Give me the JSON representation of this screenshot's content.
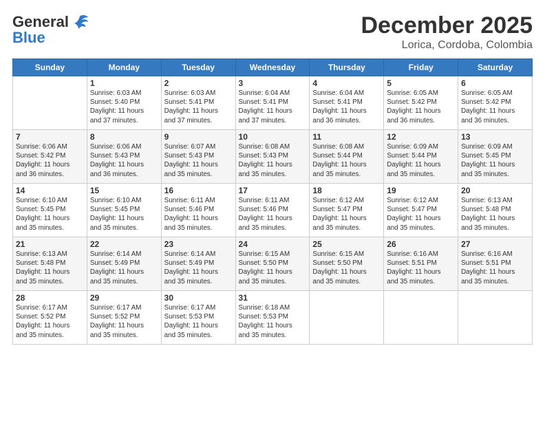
{
  "header": {
    "logo_line1": "General",
    "logo_line2": "Blue",
    "month": "December 2025",
    "location": "Lorica, Cordoba, Colombia"
  },
  "days_of_week": [
    "Sunday",
    "Monday",
    "Tuesday",
    "Wednesday",
    "Thursday",
    "Friday",
    "Saturday"
  ],
  "weeks": [
    [
      {
        "num": "",
        "info": ""
      },
      {
        "num": "1",
        "info": "Sunrise: 6:03 AM\nSunset: 5:40 PM\nDaylight: 11 hours\nand 37 minutes."
      },
      {
        "num": "2",
        "info": "Sunrise: 6:03 AM\nSunset: 5:41 PM\nDaylight: 11 hours\nand 37 minutes."
      },
      {
        "num": "3",
        "info": "Sunrise: 6:04 AM\nSunset: 5:41 PM\nDaylight: 11 hours\nand 37 minutes."
      },
      {
        "num": "4",
        "info": "Sunrise: 6:04 AM\nSunset: 5:41 PM\nDaylight: 11 hours\nand 36 minutes."
      },
      {
        "num": "5",
        "info": "Sunrise: 6:05 AM\nSunset: 5:42 PM\nDaylight: 11 hours\nand 36 minutes."
      },
      {
        "num": "6",
        "info": "Sunrise: 6:05 AM\nSunset: 5:42 PM\nDaylight: 11 hours\nand 36 minutes."
      }
    ],
    [
      {
        "num": "7",
        "info": "Sunrise: 6:06 AM\nSunset: 5:42 PM\nDaylight: 11 hours\nand 36 minutes."
      },
      {
        "num": "8",
        "info": "Sunrise: 6:06 AM\nSunset: 5:43 PM\nDaylight: 11 hours\nand 36 minutes."
      },
      {
        "num": "9",
        "info": "Sunrise: 6:07 AM\nSunset: 5:43 PM\nDaylight: 11 hours\nand 35 minutes."
      },
      {
        "num": "10",
        "info": "Sunrise: 6:08 AM\nSunset: 5:43 PM\nDaylight: 11 hours\nand 35 minutes."
      },
      {
        "num": "11",
        "info": "Sunrise: 6:08 AM\nSunset: 5:44 PM\nDaylight: 11 hours\nand 35 minutes."
      },
      {
        "num": "12",
        "info": "Sunrise: 6:09 AM\nSunset: 5:44 PM\nDaylight: 11 hours\nand 35 minutes."
      },
      {
        "num": "13",
        "info": "Sunrise: 6:09 AM\nSunset: 5:45 PM\nDaylight: 11 hours\nand 35 minutes."
      }
    ],
    [
      {
        "num": "14",
        "info": "Sunrise: 6:10 AM\nSunset: 5:45 PM\nDaylight: 11 hours\nand 35 minutes."
      },
      {
        "num": "15",
        "info": "Sunrise: 6:10 AM\nSunset: 5:45 PM\nDaylight: 11 hours\nand 35 minutes."
      },
      {
        "num": "16",
        "info": "Sunrise: 6:11 AM\nSunset: 5:46 PM\nDaylight: 11 hours\nand 35 minutes."
      },
      {
        "num": "17",
        "info": "Sunrise: 6:11 AM\nSunset: 5:46 PM\nDaylight: 11 hours\nand 35 minutes."
      },
      {
        "num": "18",
        "info": "Sunrise: 6:12 AM\nSunset: 5:47 PM\nDaylight: 11 hours\nand 35 minutes."
      },
      {
        "num": "19",
        "info": "Sunrise: 6:12 AM\nSunset: 5:47 PM\nDaylight: 11 hours\nand 35 minutes."
      },
      {
        "num": "20",
        "info": "Sunrise: 6:13 AM\nSunset: 5:48 PM\nDaylight: 11 hours\nand 35 minutes."
      }
    ],
    [
      {
        "num": "21",
        "info": "Sunrise: 6:13 AM\nSunset: 5:48 PM\nDaylight: 11 hours\nand 35 minutes."
      },
      {
        "num": "22",
        "info": "Sunrise: 6:14 AM\nSunset: 5:49 PM\nDaylight: 11 hours\nand 35 minutes."
      },
      {
        "num": "23",
        "info": "Sunrise: 6:14 AM\nSunset: 5:49 PM\nDaylight: 11 hours\nand 35 minutes."
      },
      {
        "num": "24",
        "info": "Sunrise: 6:15 AM\nSunset: 5:50 PM\nDaylight: 11 hours\nand 35 minutes."
      },
      {
        "num": "25",
        "info": "Sunrise: 6:15 AM\nSunset: 5:50 PM\nDaylight: 11 hours\nand 35 minutes."
      },
      {
        "num": "26",
        "info": "Sunrise: 6:16 AM\nSunset: 5:51 PM\nDaylight: 11 hours\nand 35 minutes."
      },
      {
        "num": "27",
        "info": "Sunrise: 6:16 AM\nSunset: 5:51 PM\nDaylight: 11 hours\nand 35 minutes."
      }
    ],
    [
      {
        "num": "28",
        "info": "Sunrise: 6:17 AM\nSunset: 5:52 PM\nDaylight: 11 hours\nand 35 minutes."
      },
      {
        "num": "29",
        "info": "Sunrise: 6:17 AM\nSunset: 5:52 PM\nDaylight: 11 hours\nand 35 minutes."
      },
      {
        "num": "30",
        "info": "Sunrise: 6:17 AM\nSunset: 5:53 PM\nDaylight: 11 hours\nand 35 minutes."
      },
      {
        "num": "31",
        "info": "Sunrise: 6:18 AM\nSunset: 5:53 PM\nDaylight: 11 hours\nand 35 minutes."
      },
      {
        "num": "",
        "info": ""
      },
      {
        "num": "",
        "info": ""
      },
      {
        "num": "",
        "info": ""
      }
    ]
  ]
}
